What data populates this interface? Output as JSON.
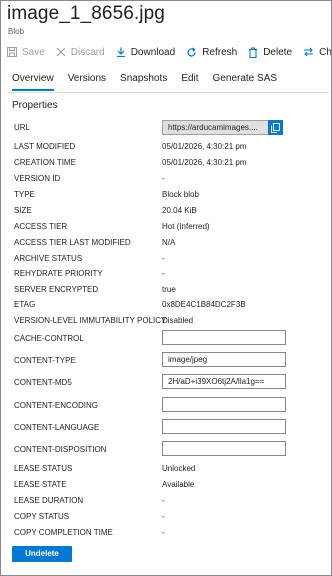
{
  "header": {
    "title": "image_1_8656.jpg",
    "subtitle": "Blob"
  },
  "toolbar": {
    "save": "Save",
    "discard": "Discard",
    "download": "Download",
    "refresh": "Refresh",
    "delete": "Delete",
    "change_tier": "Change tier"
  },
  "tabs": [
    "Overview",
    "Versions",
    "Snapshots",
    "Edit",
    "Generate SAS"
  ],
  "active_tab": "Overview",
  "section_title": "Properties",
  "props": {
    "url": {
      "label": "URL",
      "value": "https://arducamimages...."
    },
    "last_modified": {
      "label": "LAST MODIFIED",
      "value": "05/01/2026, 4:30:21 pm"
    },
    "creation_time": {
      "label": "CREATION TIME",
      "value": "05/01/2026, 4:30:21 pm"
    },
    "version_id": {
      "label": "VERSION ID",
      "value": "-"
    },
    "type": {
      "label": "TYPE",
      "value": "Block blob"
    },
    "size": {
      "label": "SIZE",
      "value": "20.04 KiB"
    },
    "access_tier": {
      "label": "ACCESS TIER",
      "value": "Hot (Inferred)"
    },
    "access_tier_last_modified": {
      "label": "ACCESS TIER LAST MODIFIED",
      "value": "N/A"
    },
    "archive_status": {
      "label": "ARCHIVE STATUS",
      "value": "-"
    },
    "rehydrate_priority": {
      "label": "REHYDRATE PRIORITY",
      "value": "-"
    },
    "server_encrypted": {
      "label": "SERVER ENCRYPTED",
      "value": "true"
    },
    "etag": {
      "label": "ETAG",
      "value": "0x8DE4C1B84DC2F3B"
    },
    "immutability_policy": {
      "label": "VERSION-LEVEL IMMUTABILITY POLICY",
      "value": "Disabled"
    },
    "cache_control": {
      "label": "CACHE-CONTROL",
      "value": ""
    },
    "content_type": {
      "label": "CONTENT-TYPE",
      "value": "image/jpeg"
    },
    "content_md5": {
      "label": "CONTENT-MD5",
      "value": "2H/aD+i39XO6tj2A/lla1g=="
    },
    "content_encoding": {
      "label": "CONTENT-ENCODING",
      "value": ""
    },
    "content_language": {
      "label": "CONTENT-LANGUAGE",
      "value": ""
    },
    "content_disposition": {
      "label": "CONTENT-DISPOSITION",
      "value": ""
    },
    "lease_status": {
      "label": "LEASE STATUS",
      "value": "Unlocked"
    },
    "lease_state": {
      "label": "LEASE STATE",
      "value": "Available"
    },
    "lease_duration": {
      "label": "LEASE DURATION",
      "value": "-"
    },
    "copy_status": {
      "label": "COPY STATUS",
      "value": "-"
    },
    "copy_completion_time": {
      "label": "COPY COMPLETION TIME",
      "value": "-"
    }
  },
  "undelete_label": "Undelete",
  "colors": {
    "accent": "#0078d4",
    "disabled": "#a19f9d"
  }
}
